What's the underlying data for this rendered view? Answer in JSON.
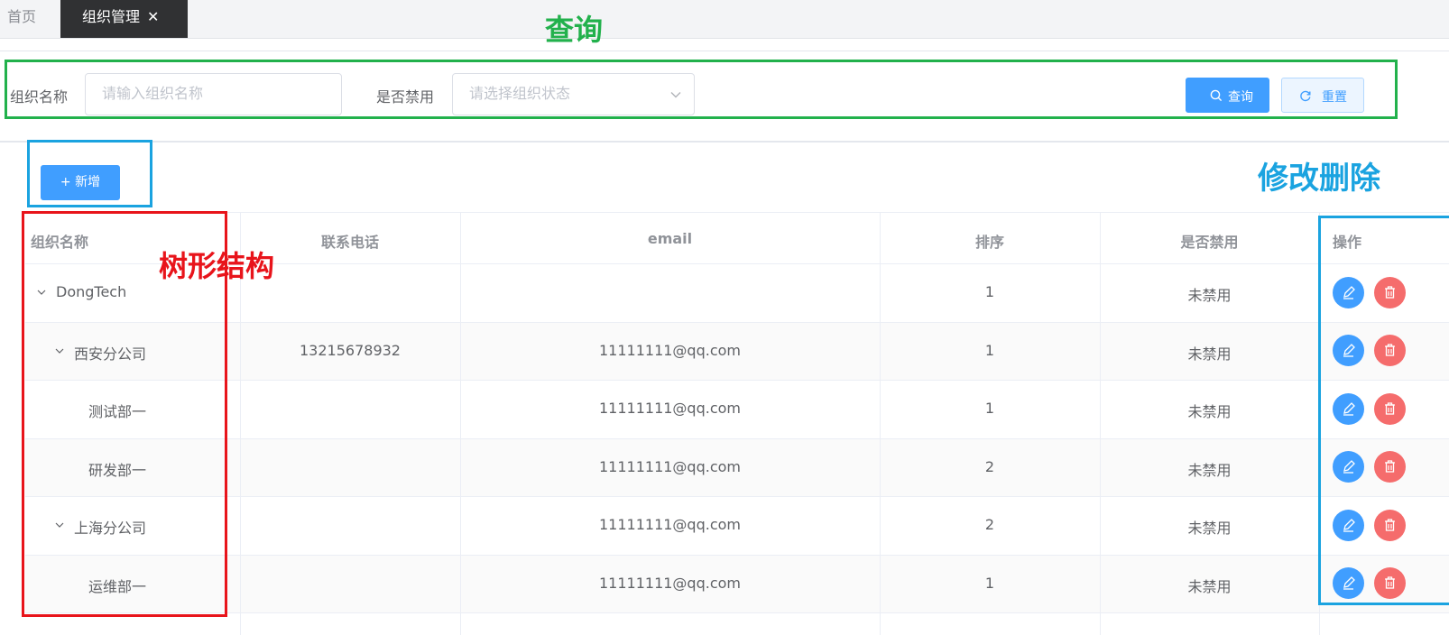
{
  "tabs": {
    "home": "首页",
    "active": "组织管理",
    "close": "✕"
  },
  "search": {
    "name_label": "组织名称",
    "name_placeholder": "请输入组织名称",
    "status_label": "是否禁用",
    "status_placeholder": "请选择组织状态",
    "query_label": "查询",
    "reset_label": "重置"
  },
  "toolbar": {
    "add_label": "+ 新增"
  },
  "annotations": {
    "query": "查询",
    "edit_delete": "修改删除",
    "tree": "树形结构",
    "colors": {
      "green": "#22b14c",
      "blue": "#1aa3e0",
      "red": "#e8141b"
    }
  },
  "table": {
    "columns": [
      "组织名称",
      "联系电话",
      "email",
      "排序",
      "是否禁用",
      "操作"
    ],
    "rows": [
      {
        "name": "DongTech",
        "level": 0,
        "expanded": true,
        "phone": "",
        "email": "",
        "sort": "1",
        "status": "未禁用"
      },
      {
        "name": "西安分公司",
        "level": 1,
        "expanded": true,
        "phone": "13215678932",
        "email": "11111111@qq.com",
        "sort": "1",
        "status": "未禁用"
      },
      {
        "name": "测试部一",
        "level": 2,
        "expanded": false,
        "phone": "",
        "email": "11111111@qq.com",
        "sort": "1",
        "status": "未禁用"
      },
      {
        "name": "研发部一",
        "level": 2,
        "expanded": false,
        "phone": "",
        "email": "11111111@qq.com",
        "sort": "2",
        "status": "未禁用"
      },
      {
        "name": "上海分公司",
        "level": 1,
        "expanded": true,
        "phone": "",
        "email": "11111111@qq.com",
        "sort": "2",
        "status": "未禁用"
      },
      {
        "name": "运维部一",
        "level": 2,
        "expanded": false,
        "phone": "",
        "email": "11111111@qq.com",
        "sort": "1",
        "status": "未禁用"
      }
    ],
    "actions": {
      "edit_icon": "edit-icon",
      "delete_icon": "trash-icon"
    }
  },
  "colors": {
    "primary": "#409eff",
    "danger": "#f56c6c",
    "tab_active_bg": "#303133"
  }
}
